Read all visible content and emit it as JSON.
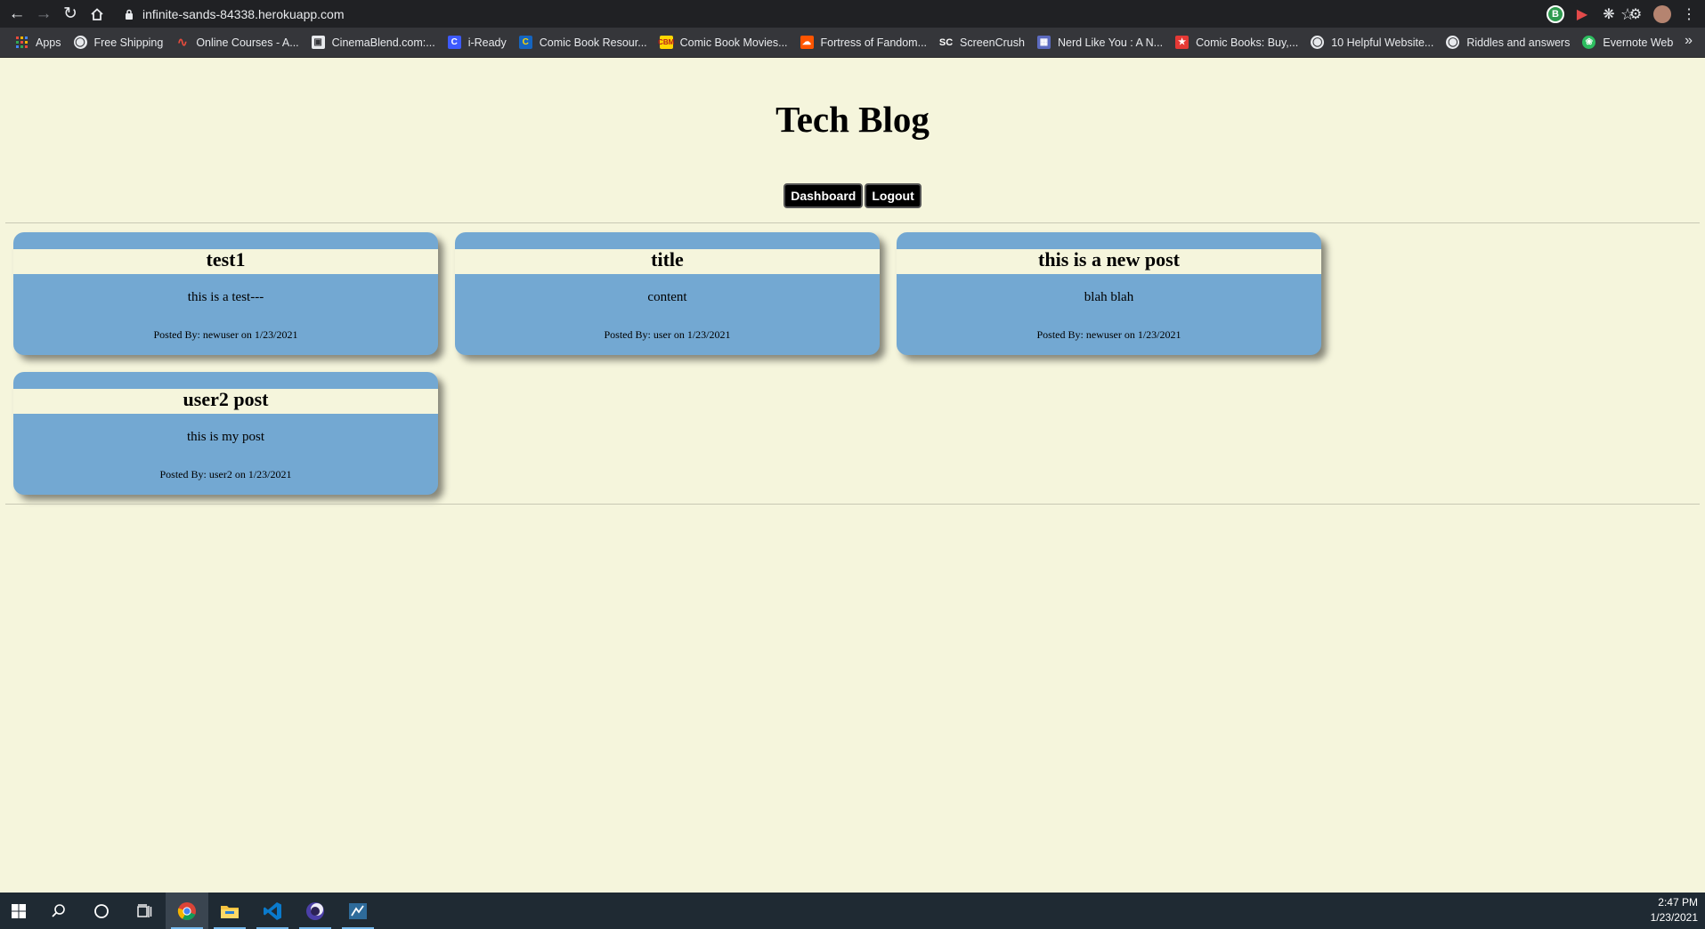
{
  "browser": {
    "url": "infinite-sands-84338.herokuapp.com",
    "extension_badge": "B",
    "bookmarks": [
      {
        "label": "Apps",
        "icon": "apps-grid-icon"
      },
      {
        "label": "Free Shipping",
        "icon": "globe-icon"
      },
      {
        "label": "Online Courses - A...",
        "icon": "courses-icon"
      },
      {
        "label": "CinemaBlend.com:...",
        "icon": "cinemablend-icon"
      },
      {
        "label": "i-Ready",
        "icon": "iready-icon"
      },
      {
        "label": "Comic Book Resour...",
        "icon": "cbr-icon"
      },
      {
        "label": "Comic Book Movies...",
        "icon": "cbm-icon"
      },
      {
        "label": "Fortress of Fandom...",
        "icon": "soundcloud-icon"
      },
      {
        "label": "ScreenCrush",
        "icon": "screencrush-icon"
      },
      {
        "label": "Nerd Like You : A N...",
        "icon": "grid-icon"
      },
      {
        "label": "Comic Books: Buy,...",
        "icon": "star-badge-icon"
      },
      {
        "label": "10 Helpful Website...",
        "icon": "globe-icon"
      },
      {
        "label": "Riddles and answers",
        "icon": "globe-icon"
      },
      {
        "label": "Evernote Web",
        "icon": "evernote-icon"
      }
    ]
  },
  "header": {
    "title": "Tech Blog",
    "nav": {
      "dashboard": "Dashboard",
      "logout": "Logout"
    }
  },
  "posts": [
    {
      "title": "test1",
      "content": "this is a test---",
      "meta": "Posted By: newuser on 1/23/2021"
    },
    {
      "title": "title",
      "content": "content",
      "meta": "Posted By: user on 1/23/2021"
    },
    {
      "title": "this is a new post",
      "content": "blah blah",
      "meta": "Posted By: newuser on 1/23/2021"
    },
    {
      "title": "user2 post",
      "content": "this is my post",
      "meta": "Posted By: user2 on 1/23/2021"
    }
  ],
  "taskbar": {
    "time": "2:47 PM",
    "date": "1/23/2021",
    "apps": [
      "windows-start-icon",
      "search-icon",
      "cortana-icon",
      "task-view-icon",
      "chrome-icon",
      "file-explorer-icon",
      "vscode-icon",
      "eclipse-icon",
      "mysql-workbench-icon"
    ]
  },
  "colors": {
    "page_bg": "#f5f5dc",
    "card_bg": "#73a8d2",
    "button_bg": "#000000"
  }
}
